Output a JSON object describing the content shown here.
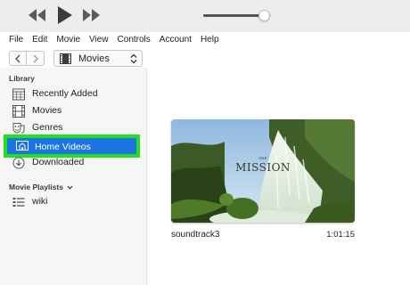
{
  "player": {
    "volume": 0.9,
    "icons": {
      "rewind": "rewind-icon",
      "play": "play-icon",
      "fast_forward": "fast-forward-icon"
    }
  },
  "menu": [
    "File",
    "Edit",
    "Movie",
    "View",
    "Controls",
    "Account",
    "Help"
  ],
  "nav": {
    "media_selector": "Movies",
    "icons": {
      "back": "chevron-left-icon",
      "forward": "chevron-right-icon",
      "selector": "film-icon"
    }
  },
  "sidebar": {
    "library_header": "Library",
    "library_items": [
      {
        "label": "Recently Added",
        "icon": "calendar-grid-icon"
      },
      {
        "label": "Movies",
        "icon": "film-icon"
      },
      {
        "label": "Genres",
        "icon": "theater-masks-icon"
      },
      {
        "label": "Home Videos",
        "icon": "home-video-icon",
        "selected": true
      },
      {
        "label": "Downloaded",
        "icon": "download-icon"
      }
    ],
    "playlists_header": "Movie Playlists",
    "playlists": [
      {
        "label": "wiki",
        "icon": "playlist-icon"
      }
    ]
  },
  "main": {
    "video": {
      "title": "soundtrack3",
      "duration": "1:01:15",
      "thumb_text": "MISSION",
      "thumb_text_small": "THE"
    }
  },
  "colors": {
    "selection_blue": "#1b74e4",
    "highlight_green": "#22e01a",
    "sidebar_bg": "#f6f6f6",
    "toolbar_bg": "#ececec"
  }
}
